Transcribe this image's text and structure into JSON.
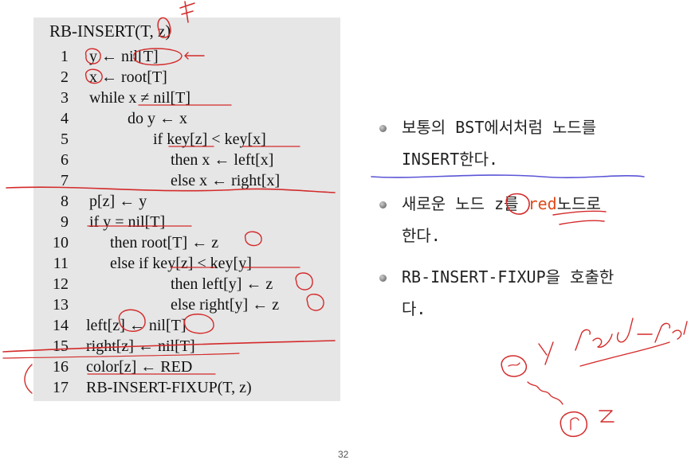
{
  "code": {
    "title": "RB-INSERT(T, z)",
    "lines": [
      {
        "num": "1",
        "text": "y ← nil[T]"
      },
      {
        "num": "2",
        "text": "x ← root[T]"
      },
      {
        "num": "3",
        "text": "while x ≠ nil[T]"
      },
      {
        "num": "4",
        "text": "do y ← x"
      },
      {
        "num": "5",
        "text": "if key[z] < key[x]"
      },
      {
        "num": "6",
        "text": "then x ← left[x]"
      },
      {
        "num": "7",
        "text": "else  x ← right[x]"
      },
      {
        "num": "8",
        "text": "p[z] ← y"
      },
      {
        "num": "9",
        "text": "if y = nil[T]"
      },
      {
        "num": "10",
        "text": "then root[T] ← z"
      },
      {
        "num": "11",
        "text": "else if key[z] < key[y]"
      },
      {
        "num": "12",
        "text": "then left[y] ← z"
      },
      {
        "num": "13",
        "text": "else right[y] ← z"
      },
      {
        "num": "14",
        "text": "left[z] ← nil[T]"
      },
      {
        "num": "15",
        "text": "right[z] ← nil[T]"
      },
      {
        "num": "16",
        "text": "color[z] ← RED"
      },
      {
        "num": "17",
        "text": "RB-INSERT-FIXUP(T, z)"
      }
    ]
  },
  "bullets": [
    {
      "text": "보통의 BST에서처럼 노드를\nINSERT한다."
    },
    {
      "pre": "새로운 노드 z를 ",
      "red": "red",
      "post": "노드로\n한다."
    },
    {
      "text": "RB-INSERT-FIXUP을 호출한\n다."
    }
  ],
  "annotations": {
    "handwritten": [
      "y",
      "red-red",
      "z",
      "bf",
      "r"
    ]
  },
  "page_number": "32",
  "colors": {
    "ink_red": "#d42a2a",
    "ink_blue": "#5a55d6",
    "highlight_red": "#e04a1a"
  }
}
